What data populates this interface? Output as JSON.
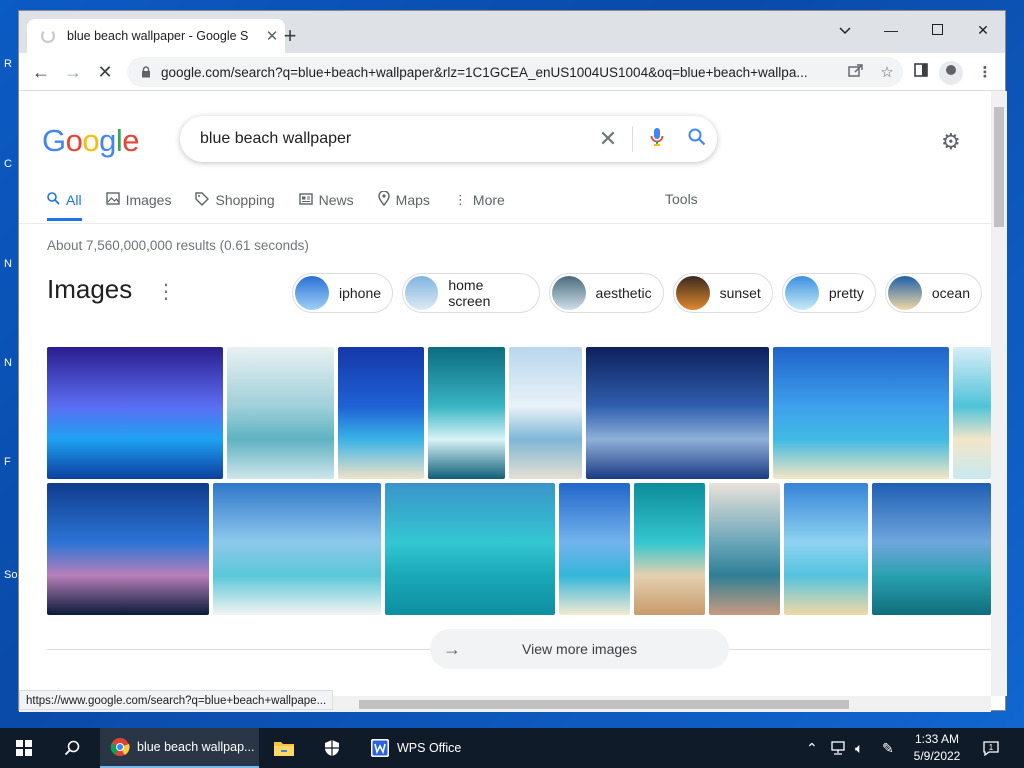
{
  "desktop": {
    "edge_letters": [
      "R",
      "C",
      "N",
      "N",
      "F",
      "So"
    ]
  },
  "browser": {
    "tab_title": "blue beach wallpaper - Google S",
    "url": "google.com/search?q=blue+beach+wallpaper&rlz=1C1GCEA_enUS1004US1004&oq=blue+beach+wallpa...",
    "status_url": "https://www.google.com/search?q=blue+beach+wallpape..."
  },
  "google": {
    "logo_letters": [
      "G",
      "o",
      "o",
      "g",
      "l",
      "e"
    ],
    "query": "blue beach wallpaper",
    "tabs": [
      {
        "label": "All",
        "icon": "search-icon",
        "active": true
      },
      {
        "label": "Images",
        "icon": "image-icon"
      },
      {
        "label": "Shopping",
        "icon": "tag-icon"
      },
      {
        "label": "News",
        "icon": "news-icon"
      },
      {
        "label": "Maps",
        "icon": "map-pin-icon"
      },
      {
        "label": "More",
        "icon": "kebab-icon"
      }
    ],
    "tools_label": "Tools",
    "result_stats": "About 7,560,000,000 results (0.61 seconds)",
    "images_heading": "Images",
    "chips": [
      {
        "label": "iphone",
        "colors": [
          "#2a6fd6",
          "#9fd1f5"
        ]
      },
      {
        "label": "home screen",
        "colors": [
          "#7fb3e0",
          "#dfeaf3"
        ]
      },
      {
        "label": "aesthetic",
        "colors": [
          "#4a6b7a",
          "#cfe0ea"
        ]
      },
      {
        "label": "sunset",
        "colors": [
          "#3a2a1f",
          "#e0892f"
        ]
      },
      {
        "label": "pretty",
        "colors": [
          "#3c8fe0",
          "#c9ecf7"
        ]
      },
      {
        "label": "ocean",
        "colors": [
          "#1f5fa8",
          "#f1d9a6"
        ]
      }
    ],
    "image_tiles": [
      {
        "row": 0,
        "colors": [
          "#2b1d8f",
          "#5b6ef2",
          "#1ea1f2",
          "#0b3f9e"
        ]
      },
      {
        "row": 0,
        "colors": [
          "#e8f1f2",
          "#9fd0d9",
          "#5fb2c2",
          "#cfe6ea"
        ]
      },
      {
        "row": 0,
        "colors": [
          "#1537a7",
          "#1f62d6",
          "#3ab2e6",
          "#f0e3c8"
        ]
      },
      {
        "row": 0,
        "colors": [
          "#0c6b7f",
          "#39b5c4",
          "#d7f3f6",
          "#0f5f78"
        ]
      },
      {
        "row": 0,
        "colors": [
          "#b9d6ee",
          "#e9f2f8",
          "#7fb7d6",
          "#e6e0d3"
        ]
      },
      {
        "row": 0,
        "colors": [
          "#0d1f5c",
          "#305fae",
          "#8fb0d8",
          "#1b3a84"
        ]
      },
      {
        "row": 0,
        "colors": [
          "#1f63c9",
          "#3ea0ec",
          "#40b9e4",
          "#f4e7c2"
        ]
      },
      {
        "row": 0,
        "colors": [
          "#d8eef7",
          "#4fc3d9",
          "#f3e6c9",
          "#c8e9ef"
        ]
      },
      {
        "row": 1,
        "colors": [
          "#0f3c8d",
          "#2b74d6",
          "#b67fb9",
          "#0a1b3a"
        ]
      },
      {
        "row": 1,
        "colors": [
          "#2f77c9",
          "#8ec9ec",
          "#5ac7d8",
          "#f4f4f2"
        ]
      },
      {
        "row": 1,
        "colors": [
          "#3a94c9",
          "#34c7d2",
          "#1aa8b8",
          "#0d8fa0"
        ]
      },
      {
        "row": 1,
        "colors": [
          "#2266c9",
          "#73b4ee",
          "#33b6d9",
          "#f3ead4"
        ]
      },
      {
        "row": 1,
        "colors": [
          "#0c8c9a",
          "#34c6cf",
          "#e4d0b0",
          "#c79b6c"
        ]
      },
      {
        "row": 1,
        "colors": [
          "#e9e2d9",
          "#6aa6b9",
          "#2f7f95",
          "#c99a80"
        ]
      },
      {
        "row": 1,
        "colors": [
          "#3683d8",
          "#8ed3f0",
          "#54c3df",
          "#f1d9a6"
        ]
      },
      {
        "row": 1,
        "colors": [
          "#1f5fb4",
          "#6fa6dc",
          "#2aa1b0",
          "#0f6d7a"
        ]
      }
    ],
    "view_more_label": "View more images"
  },
  "taskbar": {
    "items": [
      {
        "label": "blue beach wallpap...",
        "icon": "chrome-icon",
        "active": true
      },
      {
        "label": "",
        "icon": "file-explorer-icon"
      },
      {
        "label": "",
        "icon": "shield-icon"
      },
      {
        "label": "WPS Office",
        "icon": "wps-icon"
      }
    ],
    "time": "1:33 AM",
    "date": "5/9/2022"
  },
  "colors": {
    "accent": "#1a73e8",
    "desktop": "#0b5bc4",
    "taskbar": "#101b2a"
  }
}
